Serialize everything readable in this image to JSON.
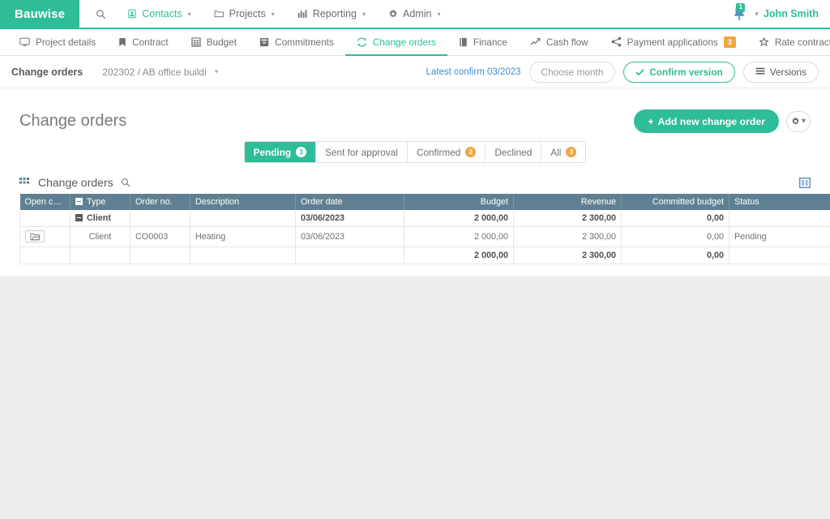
{
  "brand": {
    "name": "Bauwise",
    "color": "#2ebd98"
  },
  "topnav": {
    "search_icon": "search-icon",
    "items": [
      {
        "label": "Contacts",
        "icon": "contacts-icon",
        "active": true,
        "caret": "▾"
      },
      {
        "label": "Projects",
        "icon": "folder-icon",
        "active": false,
        "caret": "▾"
      },
      {
        "label": "Reporting",
        "icon": "bar-chart-icon",
        "active": false,
        "caret": "▾"
      },
      {
        "label": "Admin",
        "icon": "gear-icon",
        "active": false,
        "caret": "▾"
      }
    ],
    "notifications": {
      "icon": "pin-icon",
      "count": "1"
    },
    "user": {
      "name": "John Smith",
      "caret": "▾"
    }
  },
  "tabs": [
    {
      "label": "Project details",
      "icon": "monitor-icon",
      "active": false,
      "badge": ""
    },
    {
      "label": "Contract",
      "icon": "bookmark-icon",
      "active": false,
      "badge": ""
    },
    {
      "label": "Budget",
      "icon": "table-icon",
      "active": false,
      "badge": ""
    },
    {
      "label": "Commitments",
      "icon": "archive-icon",
      "active": false,
      "badge": ""
    },
    {
      "label": "Change orders",
      "icon": "refresh-icon",
      "active": true,
      "badge": ""
    },
    {
      "label": "Finance",
      "icon": "book-icon",
      "active": false,
      "badge": ""
    },
    {
      "label": "Cash flow",
      "icon": "line-chart-icon",
      "active": false,
      "badge": ""
    },
    {
      "label": "Payment applications",
      "icon": "share-icon",
      "active": false,
      "badge": "3"
    },
    {
      "label": "Rate contractors",
      "icon": "star-icon",
      "active": false,
      "badge": ""
    }
  ],
  "subbar": {
    "title": "Change orders",
    "project_value": "202302 / AB office buildi",
    "latest_confirm": "Latest confirm 03/2023",
    "choose_month_placeholder": "Choose month",
    "confirm_version_label": "Confirm version",
    "versions_label": "Versions"
  },
  "page": {
    "title": "Change orders",
    "add_button_label": "Add new change order",
    "add_button_plus": "+",
    "gear_caret": "▾"
  },
  "filters": [
    {
      "label": "Pending",
      "count": "1",
      "active": true,
      "badge_style": "white"
    },
    {
      "label": "Sent for approval",
      "count": "",
      "active": false,
      "badge_style": ""
    },
    {
      "label": "Confirmed",
      "count": "2",
      "active": false,
      "badge_style": "orange"
    },
    {
      "label": "Declined",
      "count": "",
      "active": false,
      "badge_style": ""
    },
    {
      "label": "All",
      "count": "3",
      "active": false,
      "badge_style": "orange"
    }
  ],
  "grid": {
    "name": "Change orders",
    "search_icon": "search-icon",
    "panel_icon": "columns-panel-icon",
    "columns": [
      {
        "label": "Open cha...",
        "align": "left"
      },
      {
        "label": "Type",
        "align": "left",
        "collapsible": true
      },
      {
        "label": "Order no.",
        "align": "left"
      },
      {
        "label": "Description",
        "align": "left"
      },
      {
        "label": "Order date",
        "align": "left"
      },
      {
        "label": "Budget",
        "align": "right"
      },
      {
        "label": "Revenue",
        "align": "right"
      },
      {
        "label": "Committed budget",
        "align": "right"
      },
      {
        "label": "Status",
        "align": "left"
      }
    ],
    "group_row": {
      "open": "",
      "type": "Client",
      "order_no": "",
      "description": "",
      "order_date": "03/06/2023",
      "budget": "2 000,00",
      "revenue": "2 300,00",
      "committed_budget": "0,00",
      "status": ""
    },
    "rows": [
      {
        "open_icon": "open-folder-icon",
        "type": "Client",
        "order_no": "CO0003",
        "description": "Heating",
        "order_date": "03/06/2023",
        "budget": "2 000,00",
        "revenue": "2 300,00",
        "committed_budget": "0,00",
        "status": "Pending"
      }
    ],
    "total_row": {
      "open": "",
      "type": "",
      "order_no": "",
      "description": "",
      "order_date": "",
      "budget": "2 000,00",
      "revenue": "2 300,00",
      "committed_budget": "0,00",
      "status": ""
    }
  }
}
